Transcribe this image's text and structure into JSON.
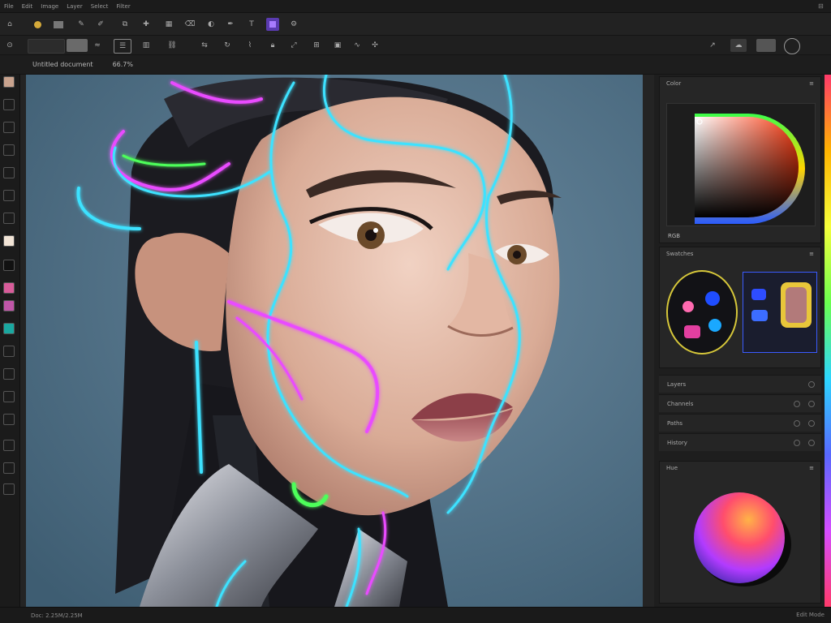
{
  "menubar": {
    "items": [
      "File",
      "Edit",
      "Image",
      "Layer",
      "Select",
      "Filter"
    ],
    "close_glyph": "⊟"
  },
  "optionsbar": {
    "file_tab": "Untitled document",
    "zoom": "66.7%"
  },
  "panels": {
    "color": {
      "title": "Color",
      "foot": "RGB"
    },
    "swatches": {
      "title": "Swatches"
    },
    "adjust_rows": [
      "Layers",
      "Channels",
      "Paths",
      "History"
    ],
    "picker": {
      "title": "Hue"
    }
  },
  "statusbar": {
    "left": "Doc: 2.25M/2.25M",
    "right": "Edit Mode"
  },
  "colors": {
    "accent_cyan": "#3de2ff",
    "accent_magenta": "#e94bff",
    "accent_green": "#4dff5a",
    "canvas_bg": "#4f7088",
    "panel_bg": "#262626"
  },
  "icons": {
    "toolrow": [
      "home-icon",
      "folder-icon",
      "eyedropper-icon",
      "brush-icon",
      "clone-icon",
      "healing-icon",
      "gradient-icon",
      "eraser-icon",
      "dodge-icon",
      "pen-icon",
      "text-icon",
      "shape-icon"
    ],
    "leftbar": [
      "move-icon",
      "marquee-icon",
      "lasso-icon",
      "crop-icon",
      "frame-icon",
      "slice-icon",
      "foreground-swatch-icon",
      "background-swatch-icon",
      "pink-swatch-icon",
      "magenta-swatch-icon",
      "teal-swatch-icon",
      "hand-icon",
      "zoom-icon",
      "grid-icon",
      "layers-icon",
      "mask-icon",
      "screen-mode-icon"
    ]
  }
}
